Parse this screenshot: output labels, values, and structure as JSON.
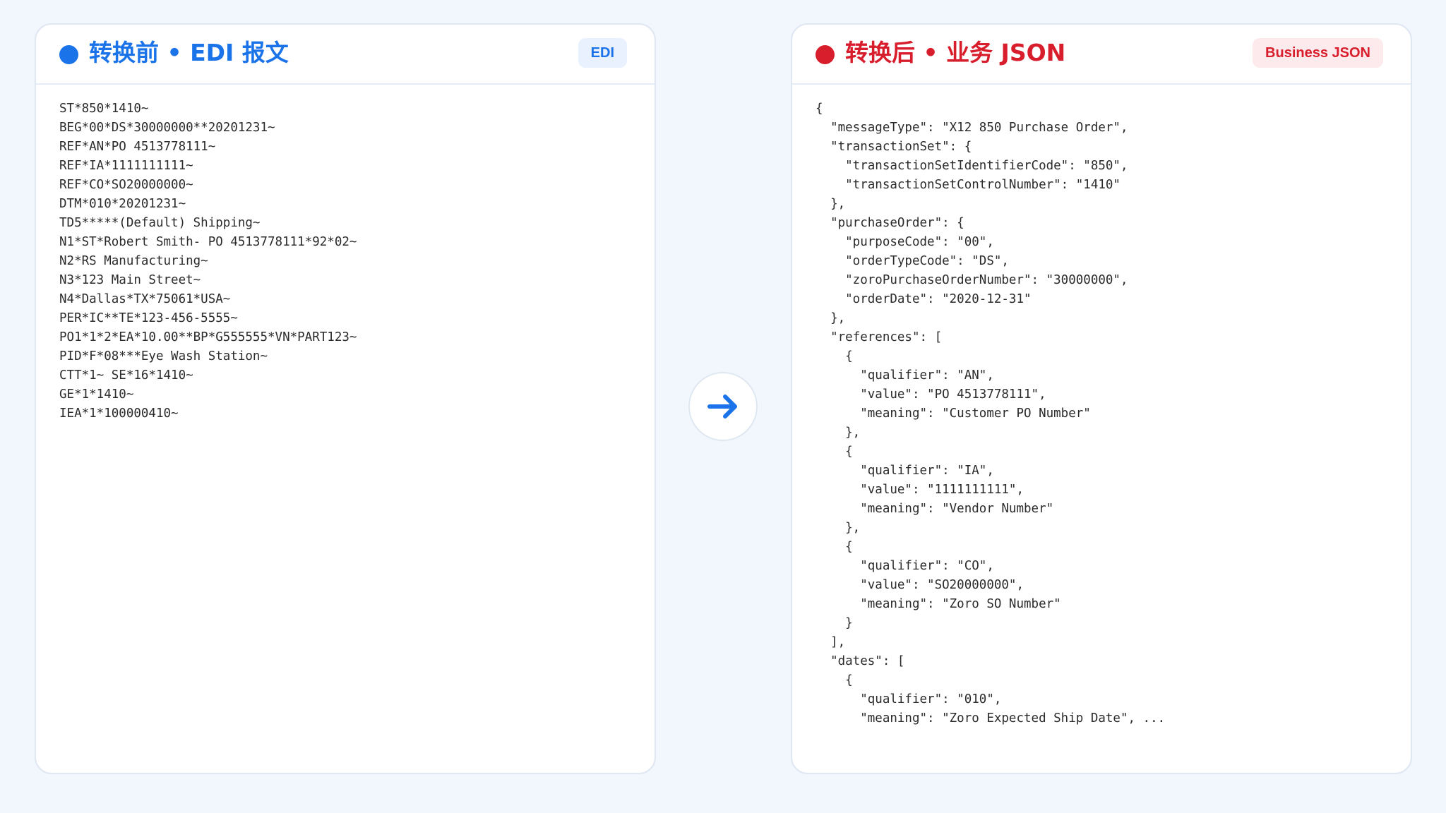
{
  "colors": {
    "page_background": "#f2f6fd",
    "edi_accent": "#1a73e8",
    "edi_badge_bg": "#e8f1fd",
    "json_accent": "#d81e2c",
    "json_badge_bg": "#fdeaec",
    "arrow": "#1a73e8"
  },
  "left_panel": {
    "title": "转换前 • EDI 报文",
    "badge": "EDI",
    "lines": [
      "ST*850*1410~",
      "BEG*00*DS*30000000**20201231~",
      "REF*AN*PO 4513778111~",
      "REF*IA*1111111111~",
      "REF*CO*SO20000000~",
      "DTM*010*20201231~",
      "TD5*****(Default) Shipping~",
      "N1*ST*Robert Smith- PO 4513778111*92*02~",
      "N2*RS Manufacturing~",
      "N3*123 Main Street~",
      "N4*Dallas*TX*75061*USA~",
      "PER*IC**TE*123-456-5555~",
      "PO1*1*2*EA*10.00**BP*G555555*VN*PART123~",
      "PID*F*08***Eye Wash Station~",
      "CTT*1~ SE*16*1410~",
      "GE*1*1410~",
      "IEA*1*100000410~"
    ]
  },
  "transfer_icon": "arrow-right-icon",
  "right_panel": {
    "title": "转换后 • 业务 JSON",
    "badge": "Business JSON",
    "lines": [
      "{",
      "  \"messageType\": \"X12 850 Purchase Order\",",
      "  \"transactionSet\": {",
      "    \"transactionSetIdentifierCode\": \"850\",",
      "    \"transactionSetControlNumber\": \"1410\"",
      "  },",
      "  \"purchaseOrder\": {",
      "    \"purposeCode\": \"00\",",
      "    \"orderTypeCode\": \"DS\",",
      "    \"zoroPurchaseOrderNumber\": \"30000000\",",
      "    \"orderDate\": \"2020-12-31\"",
      "  },",
      "  \"references\": [",
      "    {",
      "      \"qualifier\": \"AN\",",
      "      \"value\": \"PO 4513778111\",",
      "      \"meaning\": \"Customer PO Number\"",
      "    },",
      "    {",
      "      \"qualifier\": \"IA\",",
      "      \"value\": \"1111111111\",",
      "      \"meaning\": \"Vendor Number\"",
      "    },",
      "    {",
      "      \"qualifier\": \"CO\",",
      "      \"value\": \"SO20000000\",",
      "      \"meaning\": \"Zoro SO Number\"",
      "    }",
      "  ],",
      "  \"dates\": [",
      "    {",
      "      \"qualifier\": \"010\",",
      "      \"meaning\": \"Zoro Expected Ship Date\", ..."
    ]
  }
}
